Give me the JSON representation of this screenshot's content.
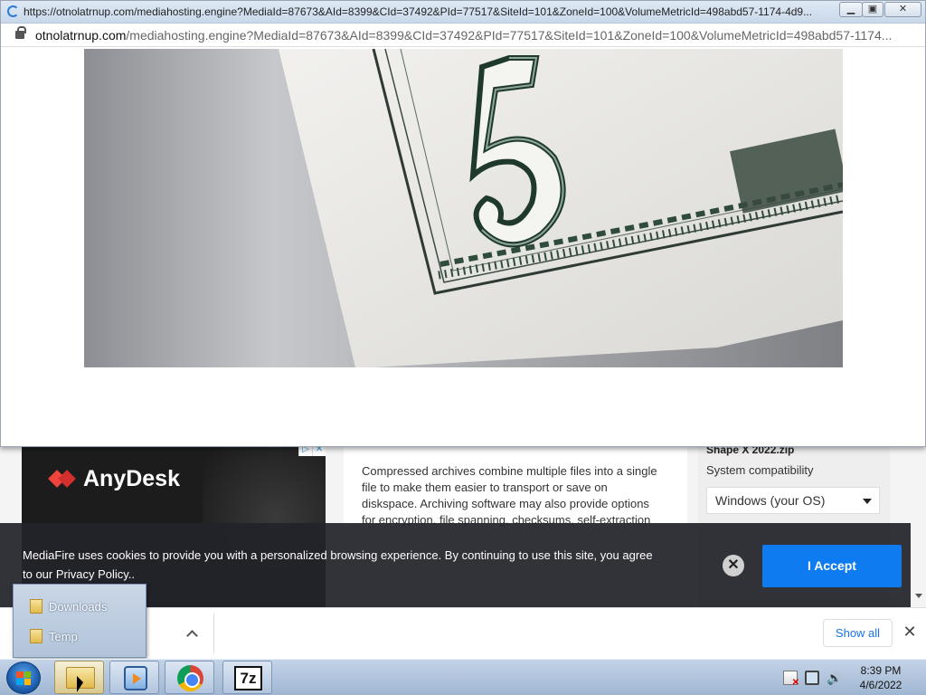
{
  "popup": {
    "title": "https://otnolatrnup.com/mediahosting.engine?MediaId=87673&AId=8399&CId=37492&PId=77517&SiteId=101&ZoneId=100&VolumeMetricId=498abd57-1174-4d9...",
    "url_host": "otnolatrnup.com",
    "url_path": "/mediahosting.engine?MediaId=87673&AId=8399&CId=37492&PId=77517&SiteId=101&ZoneId=100&VolumeMetricId=498abd57-1174..."
  },
  "page": {
    "ad_brand": "AnyDesk",
    "description": "Compressed archives combine multiple files into a single file to make them easier to transport or save on diskspace. Archiving software may also provide options for encryption, file spanning, checksums, self-extraction",
    "filename": "Shape X 2022.zip",
    "compat_label": "System compatibility",
    "os_select": "Windows (your OS)"
  },
  "cookie": {
    "message": "MediaFire uses cookies to provide you with a personalized browsing experience. By continuing to use this site, you agree to our Privacy Policy..",
    "accept_label": "I Accept"
  },
  "shelf": {
    "show_all_label": "Show all"
  },
  "jumplist": {
    "items": [
      {
        "label": "Downloads"
      },
      {
        "label": "Temp"
      }
    ]
  },
  "taskbar": {
    "time": "8:39 PM",
    "date": "4/6/2022",
    "sevenzip_label": "7z"
  },
  "icons": {
    "lock": "lock-icon",
    "close": "close-icon",
    "chevron": "chevron-up-icon",
    "folder": "folder-icon"
  },
  "colors": {
    "accept_button": "#0e7bf1",
    "cookie_bg": "#22222a",
    "show_all_text": "#1a73e8",
    "anydesk_red": "#ef443b"
  }
}
